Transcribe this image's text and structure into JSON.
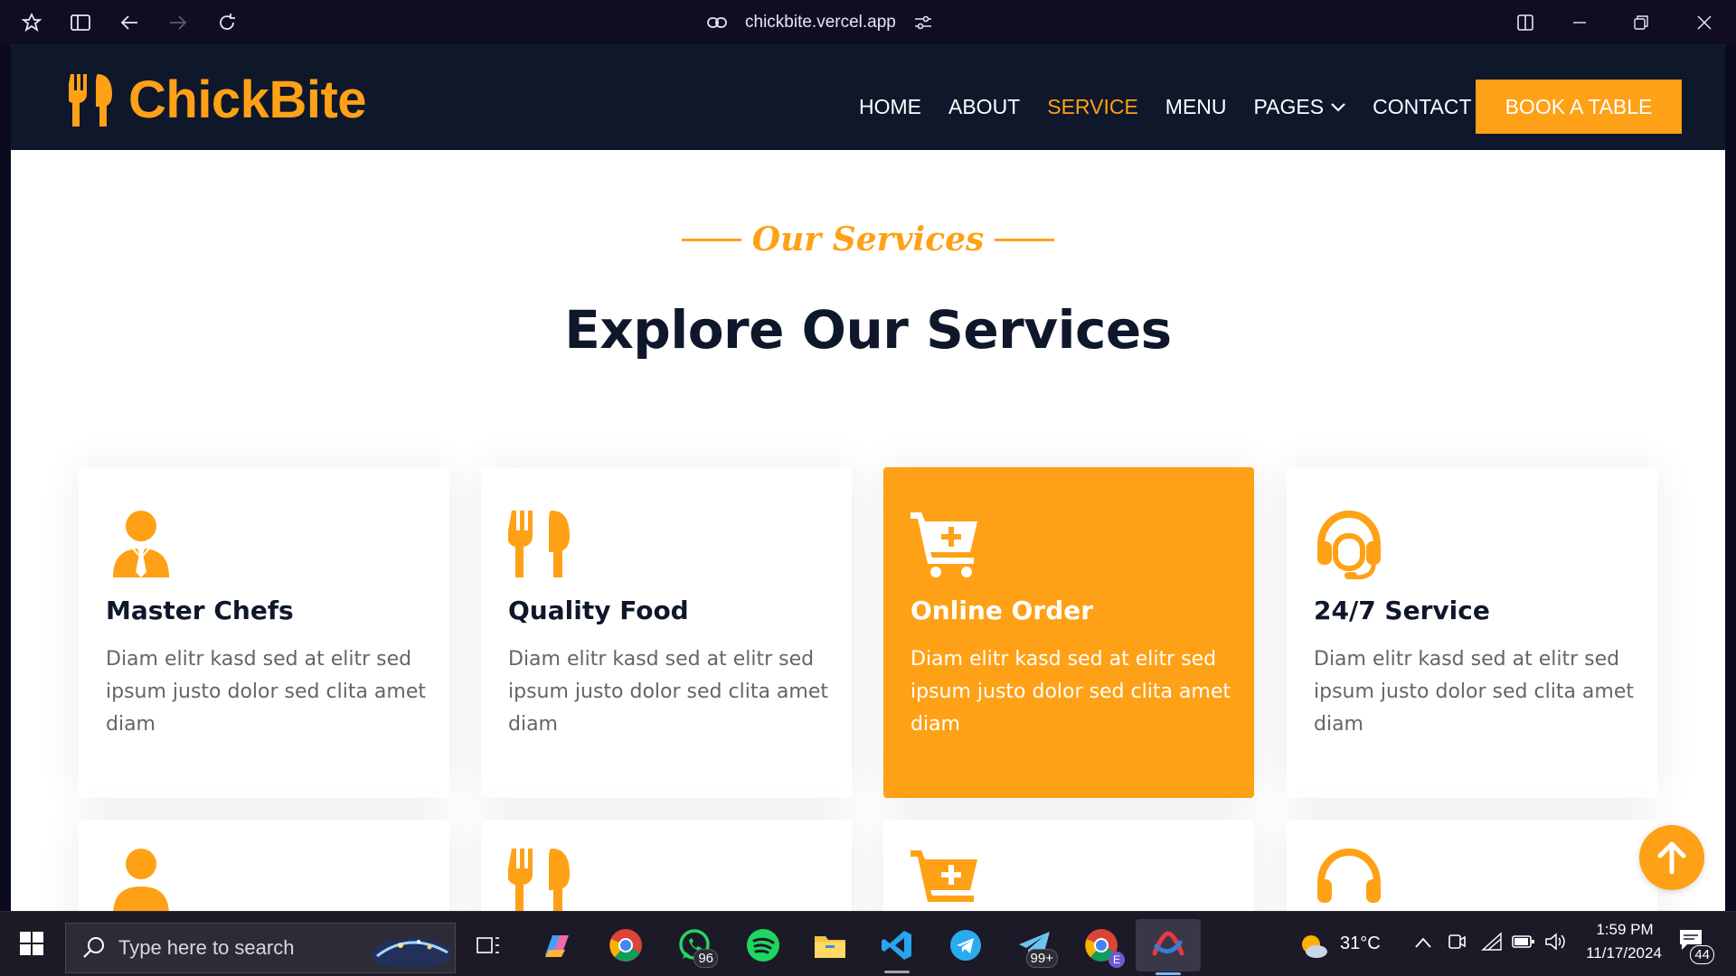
{
  "browser": {
    "url": "chickbite.vercel.app"
  },
  "navbar": {
    "brand": "ChickBite",
    "links": [
      {
        "label": "HOME",
        "active": false
      },
      {
        "label": "ABOUT",
        "active": false
      },
      {
        "label": "SERVICE",
        "active": true
      },
      {
        "label": "MENU",
        "active": false
      },
      {
        "label": "PAGES",
        "active": false,
        "dropdown": true
      },
      {
        "label": "CONTACT",
        "active": false
      }
    ],
    "cta": "BOOK A TABLE"
  },
  "section": {
    "subtitle": "Our Services",
    "title": "Explore Our Services"
  },
  "services": [
    {
      "title": "Master Chefs",
      "desc": "Diam elitr kasd sed at elitr sed ipsum justo dolor sed clita amet diam",
      "icon": "chef-icon",
      "highlight": false
    },
    {
      "title": "Quality Food",
      "desc": "Diam elitr kasd sed at elitr sed ipsum justo dolor sed clita amet diam",
      "icon": "utensils-icon",
      "highlight": false
    },
    {
      "title": "Online Order",
      "desc": "Diam elitr kasd sed at elitr sed ipsum justo dolor sed clita amet diam",
      "icon": "cart-plus-icon",
      "highlight": true
    },
    {
      "title": "24/7 Service",
      "desc": "Diam elitr kasd sed at elitr sed ipsum justo dolor sed clita amet diam",
      "icon": "headset-icon",
      "highlight": false
    }
  ],
  "colors": {
    "primary": "#fea116",
    "dark": "#0f172b",
    "text": "#666565"
  },
  "taskbar": {
    "search_placeholder": "Type here to search",
    "whatsapp_badge": "96",
    "telegram_badge": "99+",
    "chrome_profile_badge": "E",
    "weather": "31°C",
    "time": "1:59 PM",
    "date": "11/17/2024",
    "notifications": "44"
  }
}
